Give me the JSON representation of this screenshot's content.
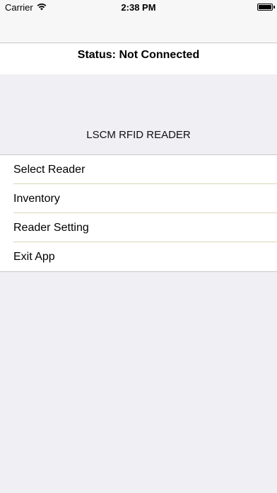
{
  "status_bar": {
    "carrier": "Carrier",
    "time": "2:38 PM",
    "wifi_icon": "wifi-icon",
    "battery_icon": "battery-icon",
    "battery_level": 1.0
  },
  "connection": {
    "status": "Status: Not Connected"
  },
  "section": {
    "title": "LSCM RFID READER"
  },
  "menu": {
    "items": [
      {
        "label": "Select Reader"
      },
      {
        "label": "Inventory"
      },
      {
        "label": "Reader Setting"
      },
      {
        "label": "Exit App"
      }
    ]
  }
}
